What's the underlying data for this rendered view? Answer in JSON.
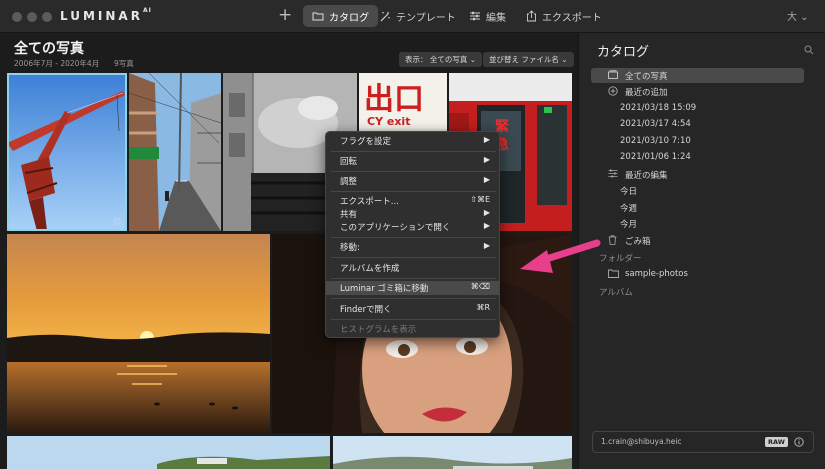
{
  "app": {
    "logo": "LUMINAR",
    "logo_suffix": "AI"
  },
  "toolbar": {
    "add_symbol": "+",
    "tabs": [
      {
        "label": "カタログ",
        "icon": "folder-icon",
        "active": true
      },
      {
        "label": "テンプレート",
        "icon": "wand-icon",
        "active": false
      },
      {
        "label": "編集",
        "icon": "sliders-icon",
        "active": false
      },
      {
        "label": "エクスポート",
        "icon": "share-icon",
        "active": false
      }
    ],
    "size_control": "大 ⌄"
  },
  "header": {
    "title": "全ての写真",
    "date_range": "2006年7月 - 2020年4月",
    "count": "9写真",
    "view_select": "表示： 全ての写真 ⌄",
    "sort_select": "並び替え ファイル名 ⌄"
  },
  "context_menu": {
    "items": [
      {
        "label": "フラグを設定",
        "right": "▶"
      },
      {
        "label": "回転",
        "right": "▶"
      },
      {
        "label": "調整",
        "right": "▶"
      },
      {
        "label": "エクスポート...",
        "right": "⇧⌘E"
      },
      {
        "label": "共有",
        "right": "▶"
      },
      {
        "label": "このアプリケーションで開く",
        "right": "▶"
      },
      {
        "label": "移動:",
        "right": "▶"
      },
      {
        "label": "アルバムを作成",
        "right": ""
      },
      {
        "label": "Luminar ゴミ箱に移動",
        "right": "⌘⌫"
      },
      {
        "label": "Finderで開く",
        "right": "⌘R"
      },
      {
        "label": "ヒストグラムを表示",
        "right": ""
      }
    ]
  },
  "panel": {
    "title": "カタログ",
    "items": [
      {
        "label": "全ての写真"
      },
      {
        "label": "最近の追加"
      },
      {
        "label": "2021/03/18 15:09"
      },
      {
        "label": "2021/03/17 4:54"
      },
      {
        "label": "2021/03/10 7:10"
      },
      {
        "label": "2021/01/06 1:24"
      },
      {
        "label": "最近の編集"
      },
      {
        "label": "今日"
      },
      {
        "label": "今週"
      },
      {
        "label": "今月"
      },
      {
        "label": "ごみ箱"
      }
    ],
    "folders_head": "フォルダー",
    "folder_item": "sample-photos",
    "albums_head": "アルバム",
    "file_name": "1.crain@shibuya.heic",
    "raw_badge": "RAW"
  },
  "colors": {
    "accent_selection": "#8fd3e8",
    "annotation_arrow": "#e83e8c"
  }
}
